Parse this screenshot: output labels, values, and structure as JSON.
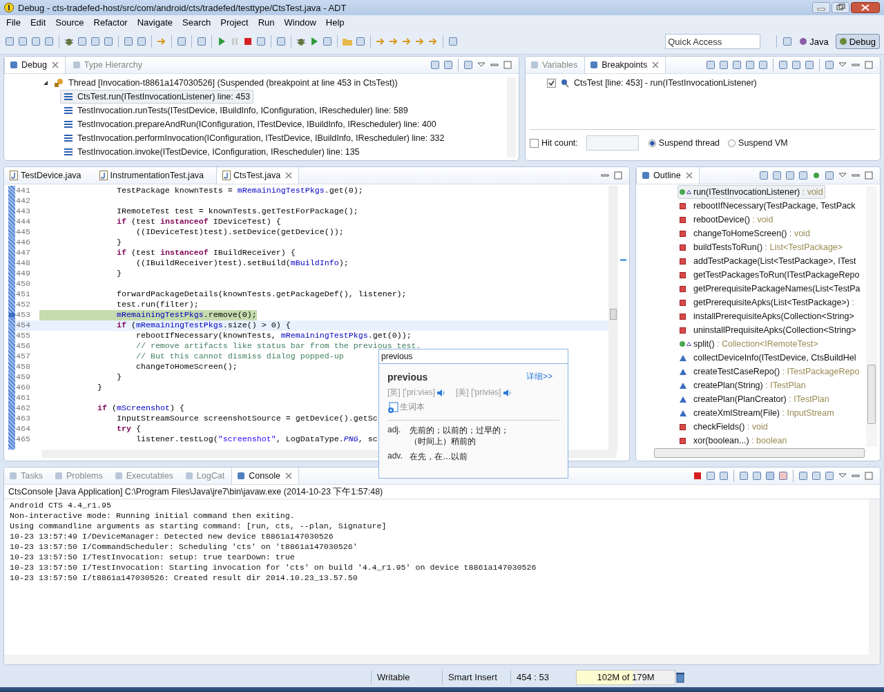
{
  "window": {
    "title": "Debug - cts-tradefed-host/src/com/android/cts/tradefed/testtype/CtsTest.java - ADT"
  },
  "menu": [
    "File",
    "Edit",
    "Source",
    "Refactor",
    "Navigate",
    "Search",
    "Project",
    "Run",
    "Window",
    "Help"
  ],
  "toolbar": {
    "quick_access": {
      "placeholder": "Quick Access"
    },
    "perspectives": [
      {
        "label": "Java",
        "selected": false
      },
      {
        "label": "Debug",
        "selected": true
      }
    ]
  },
  "debug_view": {
    "tabs": [
      {
        "label": "Debug",
        "selected": true
      },
      {
        "label": "Type Hierarchy",
        "selected": false
      }
    ],
    "thread": {
      "label": "Thread [Invocation-t8861a147030526] (Suspended (breakpoint at line 453 in CtsTest))",
      "expanded": true
    },
    "frames": [
      {
        "label": "CtsTest.run(ITestInvocationListener) line: 453",
        "selected": true
      },
      {
        "label": "TestInvocation.runTests(ITestDevice, IBuildInfo, IConfiguration, IRescheduler) line: 589",
        "selected": false
      },
      {
        "label": "TestInvocation.prepareAndRun(IConfiguration, ITestDevice, IBuildInfo, IRescheduler) line: 400",
        "selected": false
      },
      {
        "label": "TestInvocation.performInvocation(IConfiguration, ITestDevice, IBuildInfo, IRescheduler) line: 332",
        "selected": false
      },
      {
        "label": "TestInvocation.invoke(ITestDevice, IConfiguration, IRescheduler) line: 135",
        "selected": false
      }
    ]
  },
  "breakpoints_view": {
    "tabs": [
      {
        "label": "Variables",
        "selected": false
      },
      {
        "label": "Breakpoints",
        "selected": true
      }
    ],
    "items": [
      {
        "label": "CtsTest [line: 453] - run(ITestInvocationListener)",
        "checked": true
      }
    ],
    "hit_count": {
      "label": "Hit count:",
      "checked": false
    },
    "suspend_options": [
      {
        "label": "Suspend thread",
        "selected": true
      },
      {
        "label": "Suspend VM",
        "selected": false
      }
    ]
  },
  "editor": {
    "tabs": [
      {
        "label": "TestDevice.java",
        "selected": false
      },
      {
        "label": "InstrumentationTest.java",
        "selected": false
      },
      {
        "label": "CtsTest.java",
        "selected": true
      }
    ],
    "lines": [
      {
        "number": "441",
        "execution": false,
        "cursor": false,
        "segments": [
          {
            "kind": "plain",
            "text": "                TestPackage knownTests = "
          },
          {
            "kind": "field",
            "text": "mRemainingTestPkgs"
          },
          {
            "kind": "plain",
            "text": ".get(0);"
          }
        ]
      },
      {
        "number": "442",
        "execution": false,
        "cursor": false
      },
      {
        "number": "443",
        "execution": false,
        "cursor": false,
        "segments": [
          {
            "kind": "plain",
            "text": "                IRemoteTest test = knownTests.getTestForPackage();"
          }
        ]
      },
      {
        "number": "444",
        "execution": false,
        "cursor": false,
        "segments": [
          {
            "kind": "keyword",
            "text": "                if"
          },
          {
            "kind": "plain",
            "text": " (test "
          },
          {
            "kind": "keyword",
            "text": "instanceof"
          },
          {
            "kind": "plain",
            "text": " IDeviceTest) {"
          }
        ]
      },
      {
        "number": "445",
        "execution": false,
        "cursor": false,
        "segments": [
          {
            "kind": "plain",
            "text": "                    ((IDeviceTest)test).setDevice(getDevice());"
          }
        ]
      },
      {
        "number": "446",
        "execution": false,
        "cursor": false,
        "segments": [
          {
            "kind": "plain",
            "text": "                }"
          }
        ]
      },
      {
        "number": "447",
        "execution": false,
        "cursor": false,
        "segments": [
          {
            "kind": "keyword",
            "text": "                if"
          },
          {
            "kind": "plain",
            "text": " (test "
          },
          {
            "kind": "keyword",
            "text": "instanceof"
          },
          {
            "kind": "plain",
            "text": " IBuildReceiver) {"
          }
        ]
      },
      {
        "number": "448",
        "execution": false,
        "cursor": false,
        "segments": [
          {
            "kind": "plain",
            "text": "                    ((IBuildReceiver)test).setBuild("
          },
          {
            "kind": "field",
            "text": "mBuildInfo"
          },
          {
            "kind": "plain",
            "text": ");"
          }
        ]
      },
      {
        "number": "449",
        "execution": false,
        "cursor": false,
        "segments": [
          {
            "kind": "plain",
            "text": "                }"
          }
        ]
      },
      {
        "number": "450",
        "execution": false,
        "cursor": false
      },
      {
        "number": "451",
        "execution": false,
        "cursor": false,
        "segments": [
          {
            "kind": "plain",
            "text": "                forwardPackageDetails(knownTests.getPackageDef(), listener);"
          }
        ]
      },
      {
        "number": "452",
        "execution": false,
        "cursor": false,
        "segments": [
          {
            "kind": "plain",
            "text": "                test.run(filter);"
          }
        ]
      },
      {
        "number": "453",
        "execution": true,
        "cursor": false,
        "segments": [
          {
            "kind": "field",
            "text": "                mRemainingTestPkgs"
          },
          {
            "kind": "plain",
            "text": ".remove(0);"
          }
        ]
      },
      {
        "number": "454",
        "execution": false,
        "cursor": true,
        "segments": [
          {
            "kind": "keyword",
            "text": "                if"
          },
          {
            "kind": "plain",
            "text": " ("
          },
          {
            "kind": "field",
            "text": "mRemainingTestPkgs"
          },
          {
            "kind": "plain",
            "text": ".size() > 0) {"
          }
        ]
      },
      {
        "number": "455",
        "execution": false,
        "cursor": false,
        "segments": [
          {
            "kind": "plain",
            "text": "                    rebootIfNecessary(knownTests, "
          },
          {
            "kind": "field",
            "text": "mRemainingTestPkgs"
          },
          {
            "kind": "plain",
            "text": ".get(0));"
          }
        ]
      },
      {
        "number": "456",
        "execution": false,
        "cursor": false,
        "segments": [
          {
            "kind": "comment",
            "text": "                    // remove artifacts like status bar from the previous test."
          }
        ]
      },
      {
        "number": "457",
        "execution": false,
        "cursor": false,
        "segments": [
          {
            "kind": "comment",
            "text": "                    // But this cannot dismiss dialog popped-up"
          }
        ]
      },
      {
        "number": "458",
        "execution": false,
        "cursor": false,
        "segments": [
          {
            "kind": "plain",
            "text": "                    changeToHomeScreen();"
          }
        ]
      },
      {
        "number": "459",
        "execution": false,
        "cursor": false,
        "segments": [
          {
            "kind": "plain",
            "text": "                }"
          }
        ]
      },
      {
        "number": "460",
        "execution": false,
        "cursor": false,
        "segments": [
          {
            "kind": "plain",
            "text": "            }"
          }
        ]
      },
      {
        "number": "461",
        "execution": false,
        "cursor": false
      },
      {
        "number": "462",
        "execution": false,
        "cursor": false,
        "segments": [
          {
            "kind": "keyword",
            "text": "            if"
          },
          {
            "kind": "plain",
            "text": " ("
          },
          {
            "kind": "field",
            "text": "mScreenshot"
          },
          {
            "kind": "plain",
            "text": ") {"
          }
        ]
      },
      {
        "number": "463",
        "execution": false,
        "cursor": false,
        "segments": [
          {
            "kind": "plain",
            "text": "                InputStreamSource screenshotSource = getDevice().getSc"
          }
        ]
      },
      {
        "number": "464",
        "execution": false,
        "cursor": false,
        "segments": [
          {
            "kind": "keyword",
            "text": "                try"
          },
          {
            "kind": "plain",
            "text": " {"
          }
        ]
      },
      {
        "number": "465",
        "execution": false,
        "cursor": false,
        "segments": [
          {
            "kind": "plain",
            "text": "                    listener.testLog("
          },
          {
            "kind": "string",
            "text": "\"screenshot\""
          },
          {
            "kind": "plain",
            "text": ", LogDataType."
          },
          {
            "kind": "static",
            "text": "PNG"
          },
          {
            "kind": "plain",
            "text": ", sc"
          }
        ]
      }
    ]
  },
  "outline": {
    "tabs": [
      {
        "label": "Outline",
        "selected": true
      }
    ],
    "items": [
      {
        "kind": "public-override",
        "name": "run(ITestInvocationListener)",
        "type": ": void",
        "selected": true
      },
      {
        "kind": "private",
        "name": "rebootIfNecessary(TestPackage, TestPack",
        "selected": false
      },
      {
        "kind": "private",
        "name": "rebootDevice()",
        "type": ": void",
        "selected": false
      },
      {
        "kind": "private",
        "name": "changeToHomeScreen()",
        "type": ": void",
        "selected": false
      },
      {
        "kind": "private",
        "name": "buildTestsToRun()",
        "type": ": List<TestPackage>",
        "selected": false
      },
      {
        "kind": "private",
        "name": "addTestPackage(List<TestPackage>, ITest",
        "selected": false
      },
      {
        "kind": "private",
        "name": "getTestPackagesToRun(ITestPackageRepo",
        "selected": false
      },
      {
        "kind": "private",
        "name": "getPrerequisitePackageNames(List<TestPa",
        "selected": false
      },
      {
        "kind": "private",
        "name": "getPrerequisiteApks(List<TestPackage>)",
        "type": ":",
        "selected": false
      },
      {
        "kind": "private",
        "name": "installPrerequisiteApks(Collection<String>",
        "selected": false
      },
      {
        "kind": "private",
        "name": "uninstallPrequisiteApks(Collection<String>",
        "selected": false
      },
      {
        "kind": "public-override",
        "name": "split()",
        "type": ": Collection<IRemoteTest>",
        "selected": false
      },
      {
        "kind": "protected",
        "name": "collectDeviceInfo(ITestDevice, CtsBuildHel",
        "selected": false
      },
      {
        "kind": "protected",
        "name": "createTestCaseRepo()",
        "type": ": ITestPackageRepo",
        "selected": false
      },
      {
        "kind": "protected",
        "name": "createPlan(String)",
        "type": ": ITestPlan",
        "selected": false
      },
      {
        "kind": "protected",
        "name": "createPlan(PlanCreator)",
        "type": ": ITestPlan",
        "selected": false
      },
      {
        "kind": "protected",
        "name": "createXmlStream(File)",
        "type": ": InputStream",
        "selected": false
      },
      {
        "kind": "private",
        "name": "checkFields()",
        "type": ": void",
        "selected": false
      },
      {
        "kind": "private",
        "name": "xor(boolean...)",
        "type": ": boolean",
        "selected": false
      }
    ]
  },
  "console": {
    "tabs": [
      {
        "label": "Tasks",
        "selected": false
      },
      {
        "label": "Problems",
        "selected": false
      },
      {
        "label": "Executables",
        "selected": false
      },
      {
        "label": "LogCat",
        "selected": false
      },
      {
        "label": "Console",
        "selected": true
      }
    ],
    "header": "CtsConsole [Java Application] C:\\Program Files\\Java\\jre7\\bin\\javaw.exe (2014-10-23 下午1:57:48)",
    "lines": [
      "Android CTS 4.4_r1.95",
      "Non-interactive mode: Running initial command then exiting.",
      "Using commandline arguments as starting command: [run, cts, --plan, Signature]",
      "10-23 13:57:49 I/DeviceManager: Detected new device t8861a147030526",
      "10-23 13:57:50 I/CommandScheduler: Scheduling 'cts' on 't8861a147030526'",
      "10-23 13:57:50 I/TestInvocation: setup: true tearDown: true",
      "10-23 13:57:50 I/TestInvocation: Starting invocation for 'cts' on build '4.4_r1.95' on device t8861a147030526",
      "10-23 13:57:50 I/t8861a147030526: Created result dir 2014.10.23_13.57.50"
    ]
  },
  "dictionary_popup": {
    "title": "previous",
    "word": "previous",
    "details_link": "详细>>",
    "pronunciations": [
      {
        "label": "[英] ['pri:viəs]"
      },
      {
        "label": "[美] ['priviəs]"
      }
    ],
    "wordbook": "生词本",
    "definitions": [
      {
        "pos": "adj.",
        "text": "先前的；以前的；过早的；（时间上）稍前的"
      },
      {
        "pos": "adv.",
        "text": "在先，在…以前"
      }
    ]
  },
  "status_bar": {
    "mode": "Writable",
    "insert_mode": "Smart Insert",
    "position": "454 : 53",
    "heap": {
      "text": "102M of 179M",
      "level": 0.58
    }
  }
}
